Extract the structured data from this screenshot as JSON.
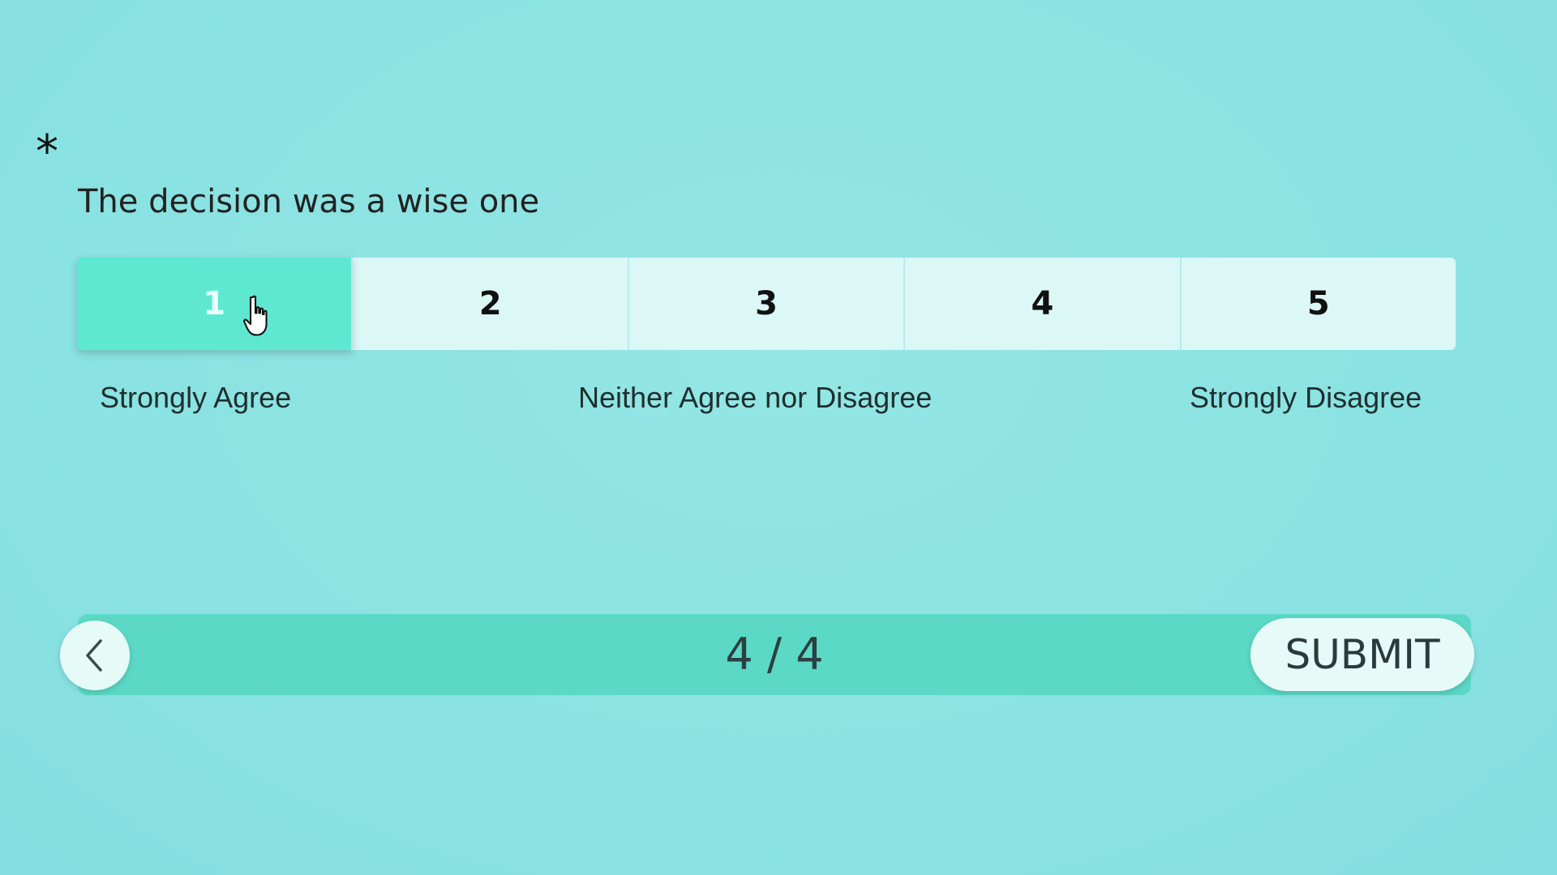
{
  "question": {
    "required_mark": "*",
    "text": "The decision was a wise one"
  },
  "scale": {
    "options": [
      "1",
      "2",
      "3",
      "4",
      "5"
    ],
    "selected_value": "1",
    "labels": {
      "left": "Strongly Agree",
      "middle": "Neither Agree nor Disagree",
      "right": "Strongly Disagree"
    }
  },
  "navigation": {
    "progress": "4 / 4",
    "back_icon": "chevron-left-icon",
    "submit_label": "SUBMIT"
  },
  "colors": {
    "background": "#8de3e3",
    "option_default": "#dbf7f6",
    "option_selected": "#5ee8d2",
    "nav_bar": "#5bd9c6",
    "button_bg": "#e6fbf8"
  },
  "cursor_icon": "pointer-hand-icon"
}
